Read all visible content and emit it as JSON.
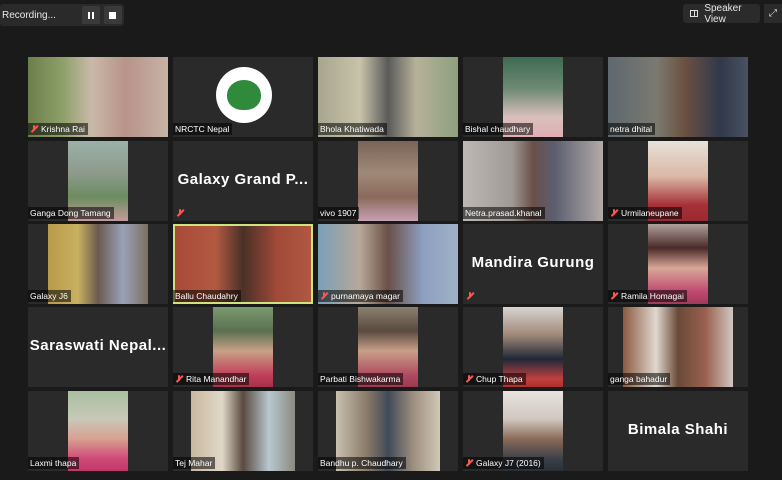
{
  "recording": {
    "label": "Recording...",
    "pause_icon": "pause-icon",
    "stop_icon": "stop-icon"
  },
  "view_button": {
    "label": "Speaker View",
    "icon": "grid-icon"
  },
  "fullscreen_icon": "fullscreen-icon",
  "accent_colors": {
    "active_speaker_border": "#cfe37c",
    "muted_icon": "#ff5555"
  },
  "participants": [
    {
      "name": "Krishna Rai",
      "muted": true
    },
    {
      "name": "NRCTC Nepal",
      "muted": false
    },
    {
      "name": "Bhola Khatiwada",
      "muted": false
    },
    {
      "name": "Bishal chaudhary",
      "muted": false
    },
    {
      "name": "netra dhital",
      "muted": false
    },
    {
      "name": "Ganga Dong Tamang",
      "muted": false
    },
    {
      "name": "Galaxy Grand P...",
      "muted": true,
      "video_off": true
    },
    {
      "name": "vivo 1907",
      "muted": false
    },
    {
      "name": "Netra.prasad.khanal",
      "muted": false
    },
    {
      "name": "Urmilaneupane",
      "muted": true
    },
    {
      "name": "Galaxy J6",
      "muted": false
    },
    {
      "name": "Ballu Chaudahry",
      "muted": false,
      "active": true
    },
    {
      "name": "purnamaya magar",
      "muted": true
    },
    {
      "name": "Mandira Gurung",
      "muted": true,
      "video_off": true
    },
    {
      "name": "Ramila Homagai",
      "muted": true
    },
    {
      "name": "Saraswati Nepal...",
      "muted": false,
      "video_off": true
    },
    {
      "name": "Rita Manandhar",
      "muted": true
    },
    {
      "name": "Parbati Bishwakarma",
      "muted": false
    },
    {
      "name": "Chup Thapa",
      "muted": true
    },
    {
      "name": "ganga bahadur",
      "muted": false
    },
    {
      "name": "Laxmi thapa",
      "muted": false
    },
    {
      "name": "Tej Mahar",
      "muted": false
    },
    {
      "name": "Bandhu p. Chaudhary",
      "muted": false
    },
    {
      "name": "Galaxy J7 (2016)",
      "muted": true
    },
    {
      "name": "Bimala Shahi",
      "muted": false,
      "video_off": true
    }
  ]
}
